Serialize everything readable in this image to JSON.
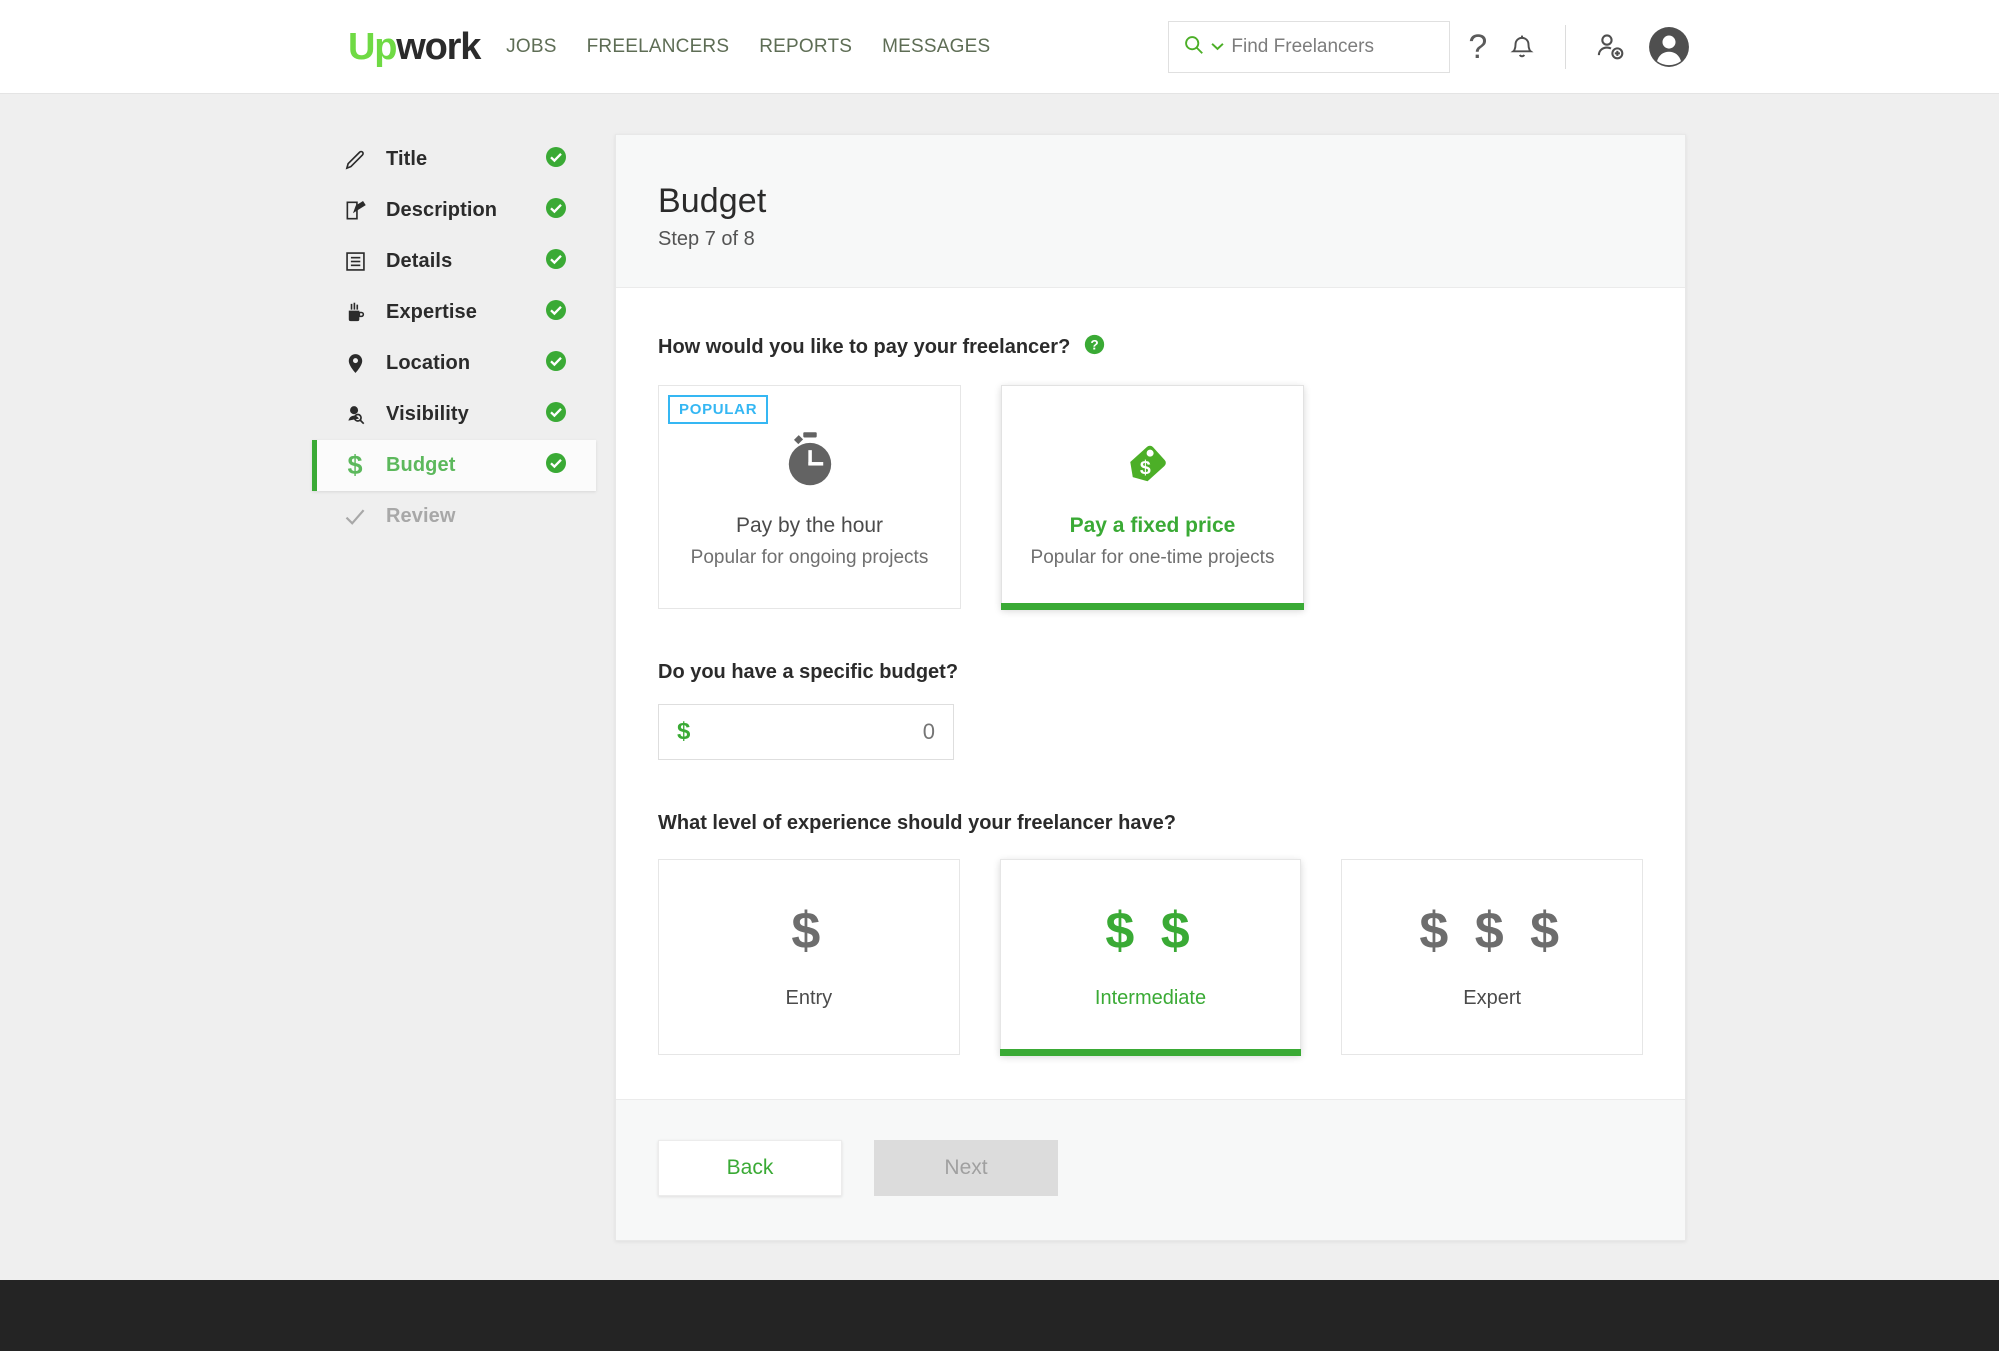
{
  "header": {
    "logo_up": "Up",
    "logo_work": "work",
    "nav": [
      {
        "label": "JOBS"
      },
      {
        "label": "FREELANCERS"
      },
      {
        "label": "REPORTS"
      },
      {
        "label": "MESSAGES"
      }
    ],
    "search": {
      "icon": "search-icon",
      "dropdown_icon": "chevron-down-icon",
      "placeholder": "Find Freelancers",
      "value": ""
    },
    "help_icon": "question-mark-icon",
    "notifications_icon": "bell-icon",
    "invite_icon": "add-person-icon",
    "avatar_icon": "user-avatar-icon"
  },
  "sidebar": {
    "steps": [
      {
        "label": "Title",
        "icon": "pencil-icon",
        "state": "complete",
        "check": true
      },
      {
        "label": "Description",
        "icon": "edit-square-icon",
        "state": "complete",
        "check": true
      },
      {
        "label": "Details",
        "icon": "list-icon",
        "state": "complete",
        "check": true
      },
      {
        "label": "Expertise",
        "icon": "pencil-cup-icon",
        "state": "complete",
        "check": true
      },
      {
        "label": "Location",
        "icon": "map-pin-icon",
        "state": "complete",
        "check": true
      },
      {
        "label": "Visibility",
        "icon": "person-search-icon",
        "state": "complete",
        "check": true
      },
      {
        "label": "Budget",
        "icon": "dollar-icon",
        "state": "active",
        "check": true
      },
      {
        "label": "Review",
        "icon": "checkmark-icon",
        "state": "upcoming",
        "check": false
      }
    ]
  },
  "card": {
    "title": "Budget",
    "subtitle": "Step 7 of 8",
    "payment_question": {
      "label": "How would you like to pay your freelancer?",
      "help_icon": "help-circle-icon",
      "options": [
        {
          "badge": "POPULAR",
          "icon": "stopwatch-icon",
          "title": "Pay by the hour",
          "desc": "Popular for ongoing projects",
          "selected": false
        },
        {
          "badge": "",
          "icon": "price-tag-icon",
          "title": "Pay a fixed price",
          "desc": "Popular for one-time projects",
          "selected": true
        }
      ]
    },
    "budget_question": {
      "label": "Do you have a specific budget?",
      "currency_symbol": "$",
      "value": "",
      "placeholder": "0"
    },
    "experience_question": {
      "label": "What level of experience should your freelancer have?",
      "options": [
        {
          "signs": "$",
          "name": "Entry",
          "selected": false
        },
        {
          "signs": "$ $",
          "name": "Intermediate",
          "selected": true
        },
        {
          "signs": "$ $ $",
          "name": "Expert",
          "selected": false
        }
      ]
    },
    "footer": {
      "back_label": "Back",
      "next_label": "Next",
      "next_disabled": true
    }
  },
  "colors": {
    "brand_green": "#6fda44",
    "accent_green": "#3aaa35",
    "badge_blue": "#35b7f3",
    "page_bg": "#efefef",
    "footer_bg": "#242424"
  }
}
